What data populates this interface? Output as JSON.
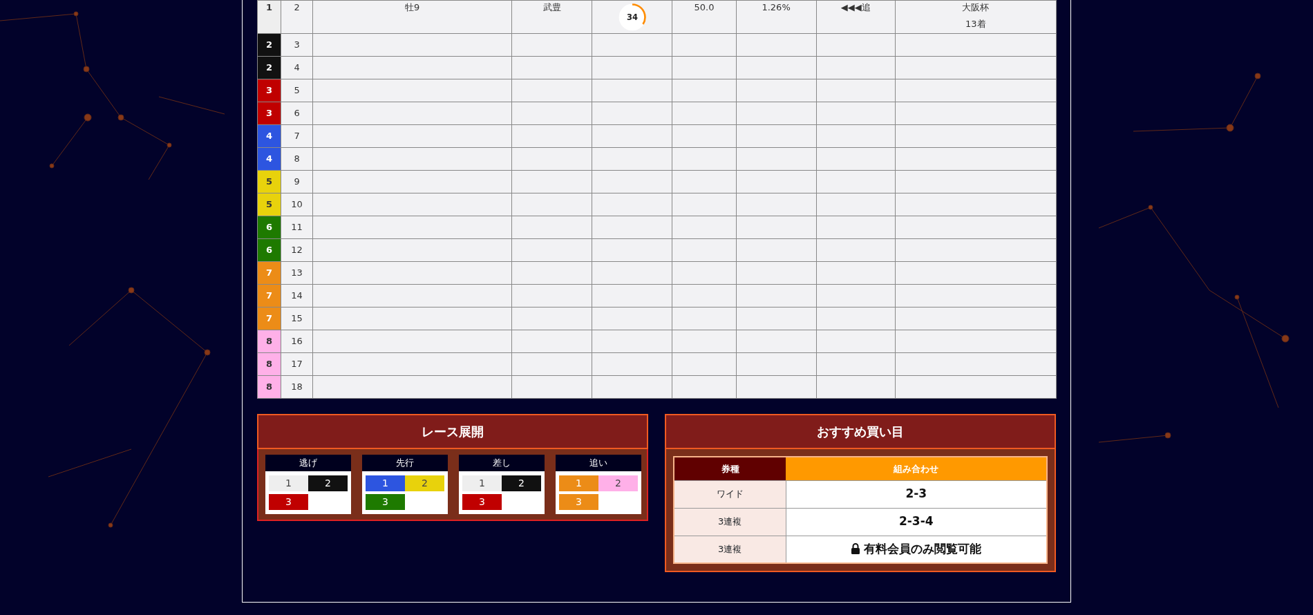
{
  "race_table": {
    "rows": [
      {
        "waku": "1",
        "color": "#eeeeee",
        "number": "2",
        "horse": "牡9",
        "jockey": "武豊",
        "score": "34",
        "level": 0.34,
        "weight": "50.0",
        "rate": "1.26%",
        "style": "◀◀◀追",
        "last_race": "大阪杯",
        "last_result": "13着"
      },
      {
        "waku": "2",
        "color": "#111111",
        "number": "3"
      },
      {
        "waku": "2",
        "color": "#111111",
        "number": "4"
      },
      {
        "waku": "3",
        "color": "#c00000",
        "number": "5"
      },
      {
        "waku": "3",
        "color": "#c00000",
        "number": "6"
      },
      {
        "waku": "4",
        "color": "#2d55e0",
        "number": "7"
      },
      {
        "waku": "4",
        "color": "#2d55e0",
        "number": "8"
      },
      {
        "waku": "5",
        "color": "#e8d20c",
        "number": "9"
      },
      {
        "waku": "5",
        "color": "#e8d20c",
        "number": "10"
      },
      {
        "waku": "6",
        "color": "#1e7a00",
        "number": "11"
      },
      {
        "waku": "6",
        "color": "#1e7a00",
        "number": "12"
      },
      {
        "waku": "7",
        "color": "#ec8c17",
        "number": "13"
      },
      {
        "waku": "7",
        "color": "#ec8c17",
        "number": "14"
      },
      {
        "waku": "7",
        "color": "#ec8c17",
        "number": "15"
      },
      {
        "waku": "8",
        "color": "#ffb0e8",
        "number": "16"
      },
      {
        "waku": "8",
        "color": "#ffb0e8",
        "number": "17"
      },
      {
        "waku": "8",
        "color": "#ffb0e8",
        "number": "18"
      }
    ]
  },
  "race_pace": {
    "title": "レース展開",
    "groups": [
      {
        "label": "逃げ",
        "horses": [
          {
            "number": "1",
            "color": "#eeeeee"
          },
          {
            "number": "2",
            "color": "#111111"
          },
          {
            "number": "3",
            "color": "#c00000"
          }
        ]
      },
      {
        "label": "先行",
        "horses": [
          {
            "number": "1",
            "color": "#2d55e0"
          },
          {
            "number": "2",
            "color": "#e8d20c"
          },
          {
            "number": "3",
            "color": "#1e7a00"
          }
        ]
      },
      {
        "label": "差し",
        "horses": [
          {
            "number": "1",
            "color": "#eeeeee"
          },
          {
            "number": "2",
            "color": "#111111"
          },
          {
            "number": "3",
            "color": "#c00000"
          }
        ]
      },
      {
        "label": "追い",
        "horses": [
          {
            "number": "1",
            "color": "#ec8c17"
          },
          {
            "number": "2",
            "color": "#ffb0e8"
          },
          {
            "number": "3",
            "color": "#ec8c17"
          }
        ]
      }
    ]
  },
  "recommended_bets": {
    "title": "おすすめ買い目",
    "columns": [
      "券種",
      "組み合わせ"
    ],
    "rows": [
      {
        "type": "ワイド",
        "combo": "2-3",
        "locked": false
      },
      {
        "type": "3連複",
        "combo": "2-3-4",
        "locked": false
      },
      {
        "type": "3連複",
        "combo": "有料会員のみ閲覧可能",
        "locked": true
      }
    ]
  }
}
